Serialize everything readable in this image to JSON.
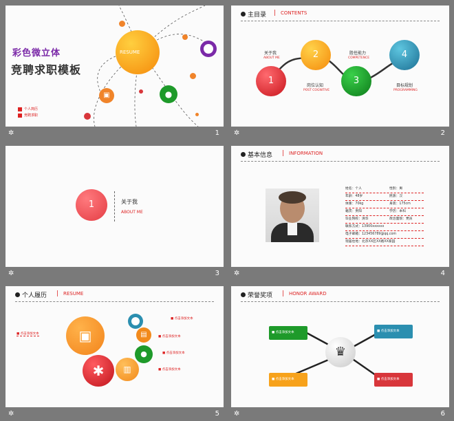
{
  "colors": {
    "accent": "#d22222",
    "orange": "#f7a21b",
    "green": "#1e9a2a",
    "teal": "#2b8fb0",
    "red": "#d8363b",
    "purple": "#7b2aa8"
  },
  "slide1": {
    "title_line1": "彩色微立体",
    "title_line2": "竞聘求职模板",
    "center_label": "RESUME",
    "legend": [
      "个人简历",
      "竞聘求职"
    ],
    "icons": [
      "briefcase-icon",
      "user-icon",
      "chat-icon"
    ]
  },
  "slide2": {
    "header": "主目录",
    "header_en": "CONTENTS",
    "items": [
      {
        "num": "1",
        "title": "关于我",
        "en": "ABOUT ME"
      },
      {
        "num": "2",
        "title": "岗位认知",
        "en": "POST COGNITIVE"
      },
      {
        "num": "3",
        "title": "胜任能力",
        "en": "COMPETENCE"
      },
      {
        "num": "4",
        "title": "目标规划",
        "en": "PROGRAMMING"
      }
    ]
  },
  "slide3": {
    "num": "1",
    "title": "关于我",
    "en": "ABOUT ME"
  },
  "slide4": {
    "header": "基本信息",
    "header_en": "INFORMATION",
    "rows": [
      [
        "姓名：个人",
        "性别：男"
      ],
      [
        "年龄：48岁",
        "民族：汉"
      ],
      [
        "体重：70kg",
        "身高：175cm"
      ],
      [
        "籍贯：贵阳",
        "学历：本科"
      ],
      [
        "毕业院校：清华",
        "政治面貌：党员"
      ],
      [
        "联系方式：13900xxxxxx",
        ""
      ],
      [
        "电子邮箱：123456789@qq.com",
        ""
      ],
      [
        "现居住地：北京XX区XX路XX家园",
        ""
      ]
    ]
  },
  "slide5": {
    "header": "个人履历",
    "header_en": "RESUME",
    "left_text": "■ 点击添加文本",
    "right_texts": [
      "■ 点击添加文本",
      "■ 点击添加文本",
      "■ 点击添加文本",
      "■ 点击添加文本"
    ],
    "icons": [
      "briefcase-icon",
      "gear-icon",
      "chart-icon",
      "user-icon",
      "chat-icon"
    ]
  },
  "slide6": {
    "header": "荣誉奖项",
    "header_en": "HONOR AWARD",
    "boxes": [
      "■ 点击添加文本",
      "■ 点击添加文本",
      "■ 点击添加文本",
      "■ 点击添加文本"
    ],
    "icon": "trophy-icon"
  },
  "footer": {
    "star": "✲",
    "nums": [
      "1",
      "2",
      "3",
      "4",
      "5",
      "6"
    ]
  }
}
